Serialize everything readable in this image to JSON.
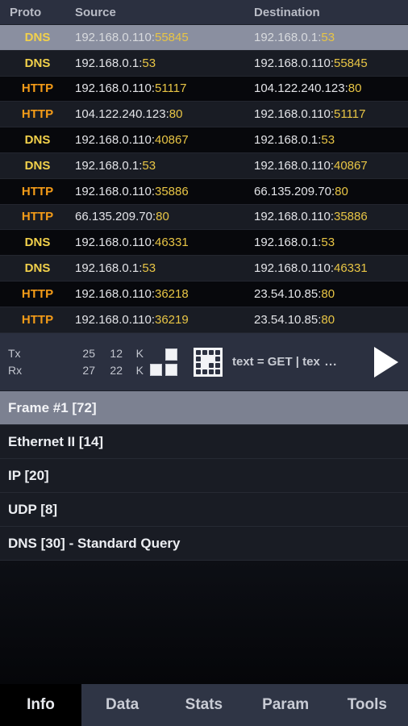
{
  "list_header": {
    "proto": "Proto",
    "source": "Source",
    "destination": "Destination"
  },
  "packets": [
    {
      "proto": "DNS",
      "src_ip": "192.168.0.110",
      "src_port": "55845",
      "dst_ip": "192.168.0.1",
      "dst_port": "53",
      "selected": true
    },
    {
      "proto": "DNS",
      "src_ip": "192.168.0.1",
      "src_port": "53",
      "dst_ip": "192.168.0.110",
      "dst_port": "55845",
      "selected": false
    },
    {
      "proto": "HTTP",
      "src_ip": "192.168.0.110",
      "src_port": "51117",
      "dst_ip": "104.122.240.123",
      "dst_port": "80",
      "selected": false
    },
    {
      "proto": "HTTP",
      "src_ip": "104.122.240.123",
      "src_port": "80",
      "dst_ip": "192.168.0.110",
      "dst_port": "51117",
      "selected": false
    },
    {
      "proto": "DNS",
      "src_ip": "192.168.0.110",
      "src_port": "40867",
      "dst_ip": "192.168.0.1",
      "dst_port": "53",
      "selected": false
    },
    {
      "proto": "DNS",
      "src_ip": "192.168.0.1",
      "src_port": "53",
      "dst_ip": "192.168.0.110",
      "dst_port": "40867",
      "selected": false
    },
    {
      "proto": "HTTP",
      "src_ip": "192.168.0.110",
      "src_port": "35886",
      "dst_ip": "66.135.209.70",
      "dst_port": "80",
      "selected": false
    },
    {
      "proto": "HTTP",
      "src_ip": "66.135.209.70",
      "src_port": "80",
      "dst_ip": "192.168.0.110",
      "dst_port": "35886",
      "selected": false
    },
    {
      "proto": "DNS",
      "src_ip": "192.168.0.110",
      "src_port": "46331",
      "dst_ip": "192.168.0.1",
      "dst_port": "53",
      "selected": false
    },
    {
      "proto": "DNS",
      "src_ip": "192.168.0.1",
      "src_port": "53",
      "dst_ip": "192.168.0.110",
      "dst_port": "46331",
      "selected": false
    },
    {
      "proto": "HTTP",
      "src_ip": "192.168.0.110",
      "src_port": "36218",
      "dst_ip": "23.54.10.85",
      "dst_port": "80",
      "selected": false
    },
    {
      "proto": "HTTP",
      "src_ip": "192.168.0.110",
      "src_port": "36219",
      "dst_ip": "23.54.10.85",
      "dst_port": "80",
      "selected": false
    }
  ],
  "toolbar": {
    "tx_label": "Tx",
    "tx_count": "25",
    "tx_bytes": "12",
    "tx_unit": "K",
    "rx_label": "Rx",
    "rx_count": "27",
    "rx_bytes": "22",
    "rx_unit": "K",
    "squares_icon": "squares-icon",
    "grid_icon": "grid-matrix-icon",
    "filter_text": "text = GET | tex",
    "filter_ellipsis": "...",
    "play_icon": "play-icon"
  },
  "tree": [
    {
      "label": "Frame #1 [72]",
      "selected": true
    },
    {
      "label": "Ethernet II [14]",
      "selected": false
    },
    {
      "label": "IP [20]",
      "selected": false
    },
    {
      "label": "UDP [8]",
      "selected": false
    },
    {
      "label": "DNS [30] - Standard Query",
      "selected": false
    }
  ],
  "tabs": [
    {
      "label": "Info",
      "active": true
    },
    {
      "label": "Data",
      "active": false
    },
    {
      "label": "Stats",
      "active": false
    },
    {
      "label": "Param",
      "active": false
    },
    {
      "label": "Tools",
      "active": false
    }
  ],
  "colors": {
    "dns": "#f2d14b",
    "http": "#f59c18",
    "port": "#e8c545",
    "selected_row": "#8a8fa0",
    "toolbar_bg": "#2b3040",
    "tab_bg": "#2f3545"
  }
}
